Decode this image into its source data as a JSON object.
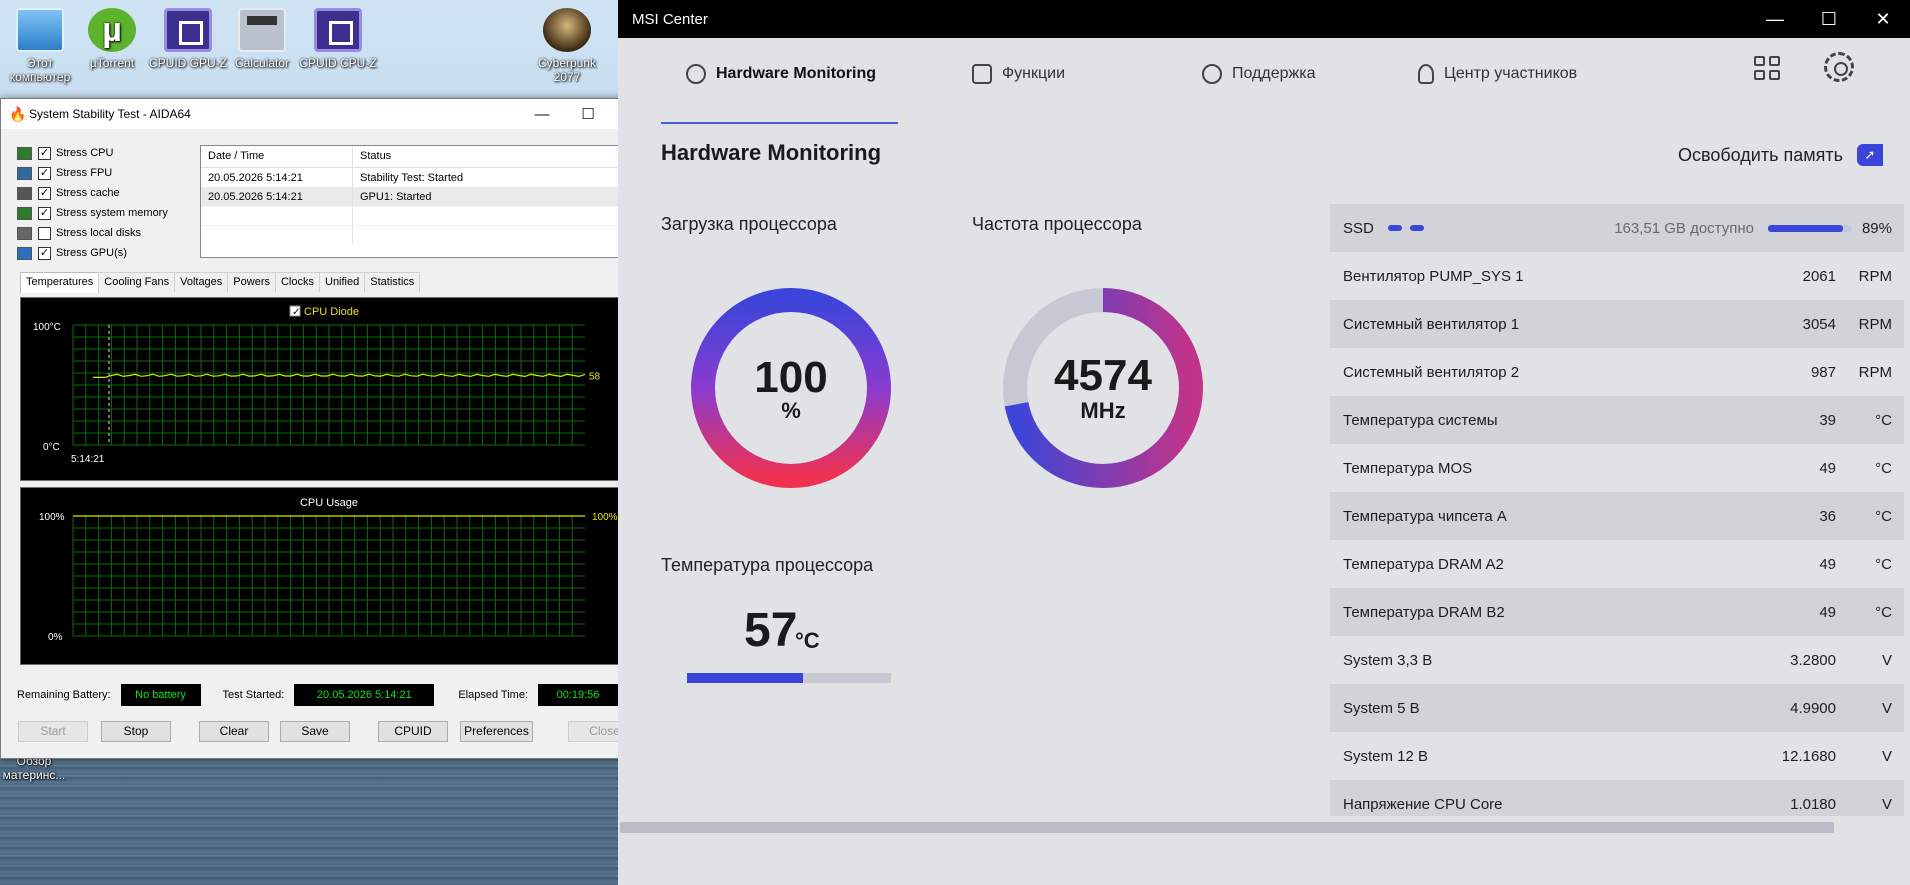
{
  "desktop": {
    "icons": [
      {
        "label": "Этот компьютер",
        "icon": "computer-icon"
      },
      {
        "label": "µTorrent",
        "icon": "utorrent-icon"
      },
      {
        "label": "CPUID GPU-Z",
        "icon": "cpuid-gpuz-icon"
      },
      {
        "label": "Calculator",
        "icon": "calculator-icon"
      },
      {
        "label": "CPUID CPU-Z",
        "icon": "cpuid-cpuz-icon"
      },
      {
        "label": "Cyberpunk 2077",
        "icon": "cyberpunk-icon"
      },
      {
        "label": "Обзор материнс...",
        "icon": "document-icon"
      }
    ]
  },
  "aida": {
    "title": "System Stability Test - AIDA64",
    "options": [
      {
        "label": "Stress CPU",
        "checked": true
      },
      {
        "label": "Stress FPU",
        "checked": true
      },
      {
        "label": "Stress cache",
        "checked": true
      },
      {
        "label": "Stress system memory",
        "checked": true
      },
      {
        "label": "Stress local disks",
        "checked": false
      },
      {
        "label": "Stress GPU(s)",
        "checked": true
      }
    ],
    "log": {
      "headers": [
        "Date / Time",
        "Status"
      ],
      "rows": [
        [
          "20.05.2026 5:14:21",
          "Stability Test: Started"
        ],
        [
          "20.05.2026 5:14:21",
          "GPU1: Started"
        ]
      ]
    },
    "tabs": [
      "Temperatures",
      "Cooling Fans",
      "Voltages",
      "Powers",
      "Clocks",
      "Unified",
      "Statistics"
    ],
    "active_tab": "Temperatures",
    "temp_graph": {
      "legend": "CPU Diode",
      "y_top": "100°C",
      "y_bottom": "0°C",
      "x_start": "5:14:21",
      "current_value": "58",
      "current": 58,
      "line_color": "#e6e600"
    },
    "usage_graph": {
      "title": "CPU Usage",
      "y_top": "100%",
      "y_bottom": "0%",
      "current_value": "100%",
      "current": 100
    },
    "status": {
      "battery_label": "Remaining Battery:",
      "battery_value": "No battery",
      "started_label": "Test Started:",
      "started_value": "20.05.2026 5:14:21",
      "elapsed_label": "Elapsed Time:",
      "elapsed_value": "00:19:56"
    },
    "buttons": {
      "start": "Start",
      "stop": "Stop",
      "clear": "Clear",
      "save": "Save",
      "cpuid": "CPUID",
      "preferences": "Preferences",
      "close": "Close"
    }
  },
  "msi": {
    "title": "MSI Center",
    "nav": [
      {
        "label": "Hardware Monitoring",
        "icon": "speedometer-icon",
        "active": true
      },
      {
        "label": "Функции",
        "icon": "functions-icon",
        "active": false
      },
      {
        "label": "Поддержка",
        "icon": "support-icon",
        "active": false
      },
      {
        "label": "Центр участников",
        "icon": "user-icon",
        "active": false
      }
    ],
    "page_title": "Hardware Monitoring",
    "free_memory_label": "Освободить память",
    "cpu_load": {
      "label": "Загрузка процессора",
      "value": "100",
      "unit": "%",
      "percent": 100
    },
    "cpu_freq": {
      "label": "Частота процессора",
      "value": "4574",
      "unit": "MHz",
      "fraction": 0.72
    },
    "cpu_temp": {
      "label": "Температура процессора",
      "value": "57",
      "unit": "°C",
      "fraction": 0.57
    },
    "accent_color": "#3b45d9",
    "ssd": {
      "name": "SSD",
      "available": "163,51 GB доступно",
      "percent": "89%",
      "fraction": 0.89
    },
    "sensors": [
      {
        "name": "Вентилятор PUMP_SYS 1",
        "value": "2061",
        "unit": "RPM"
      },
      {
        "name": "Системный вентилятор 1",
        "value": "3054",
        "unit": "RPM"
      },
      {
        "name": "Системный вентилятор 2",
        "value": "987",
        "unit": "RPM"
      },
      {
        "name": "Температура системы",
        "value": "39",
        "unit": "°C"
      },
      {
        "name": "Температура MOS",
        "value": "49",
        "unit": "°C"
      },
      {
        "name": "Температура чипсета A",
        "value": "36",
        "unit": "°C"
      },
      {
        "name": "Температура DRAM A2",
        "value": "49",
        "unit": "°C"
      },
      {
        "name": "Температура DRAM B2",
        "value": "49",
        "unit": "°C"
      },
      {
        "name": "System 3,3 В",
        "value": "3.2800",
        "unit": "V"
      },
      {
        "name": "System 5 В",
        "value": "4.9900",
        "unit": "V"
      },
      {
        "name": "System 12 В",
        "value": "12.1680",
        "unit": "V"
      },
      {
        "name": "Напряжение CPU Core",
        "value": "1.0180",
        "unit": "V"
      }
    ]
  }
}
